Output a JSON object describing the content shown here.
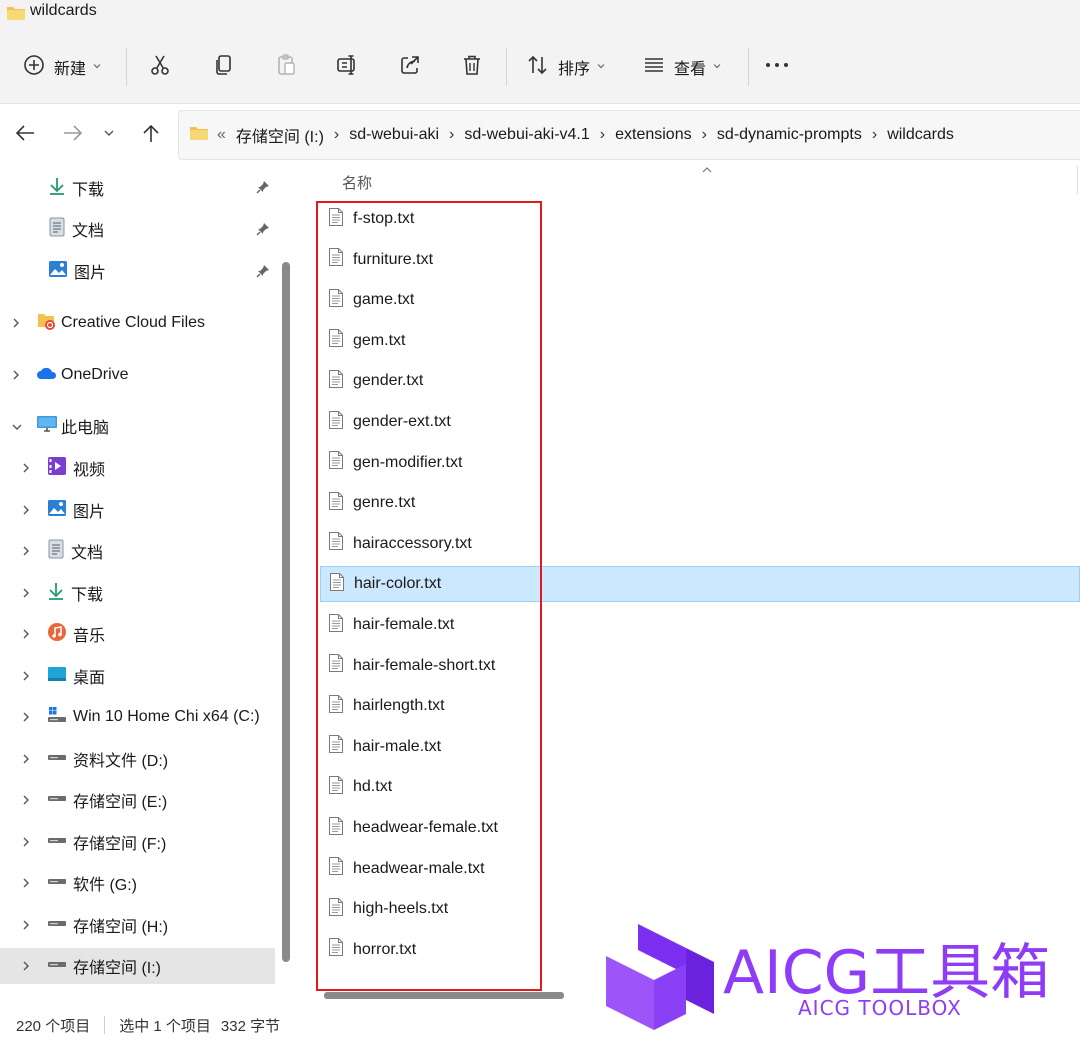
{
  "window": {
    "title": "wildcards"
  },
  "toolbar": {
    "new_label": "新建",
    "sort_label": "排序",
    "view_label": "查看",
    "icons": [
      "plus-circle-icon",
      "cut-icon",
      "copy-icon",
      "paste-icon",
      "rename-icon",
      "share-icon",
      "delete-icon",
      "sort-icon",
      "view-icon",
      "more-icon"
    ]
  },
  "addressbar": {
    "overflow": "«",
    "crumbs": [
      "存储空间 (I:)",
      "sd-webui-aki",
      "sd-webui-aki-v4.1",
      "extensions",
      "sd-dynamic-prompts",
      "wildcards"
    ],
    "separator": "›"
  },
  "sidebar": {
    "quick_access": [
      {
        "label": "下载",
        "icon": "download-icon",
        "pinned": true
      },
      {
        "label": "文档",
        "icon": "document-icon",
        "pinned": true
      },
      {
        "label": "图片",
        "icon": "pictures-icon",
        "pinned": true
      }
    ],
    "roots": [
      {
        "label": "Creative Cloud Files",
        "icon": "creative-cloud-folder-icon"
      },
      {
        "label": "OneDrive",
        "icon": "onedrive-icon"
      },
      {
        "label": "此电脑",
        "icon": "this-pc-icon"
      }
    ],
    "this_pc": [
      {
        "label": "视频",
        "icon": "videos-icon"
      },
      {
        "label": "图片",
        "icon": "pictures-icon"
      },
      {
        "label": "文档",
        "icon": "document-icon"
      },
      {
        "label": "下载",
        "icon": "download-icon"
      },
      {
        "label": "音乐",
        "icon": "music-icon"
      },
      {
        "label": "桌面",
        "icon": "desktop-icon"
      },
      {
        "label": "Win 10 Home Chi x64 (C:)",
        "icon": "windows-drive-icon"
      },
      {
        "label": "资料文件 (D:)",
        "icon": "drive-icon"
      },
      {
        "label": "存储空间 (E:)",
        "icon": "drive-icon"
      },
      {
        "label": "存储空间 (F:)",
        "icon": "drive-icon"
      },
      {
        "label": "软件 (G:)",
        "icon": "drive-icon"
      },
      {
        "label": "存储空间 (H:)",
        "icon": "drive-icon"
      },
      {
        "label": "存储空间 (I:)",
        "icon": "drive-icon",
        "selected": true
      }
    ]
  },
  "file_list": {
    "column_header": "名称",
    "files": [
      "f-stop.txt",
      "furniture.txt",
      "game.txt",
      "gem.txt",
      "gender.txt",
      "gender-ext.txt",
      "gen-modifier.txt",
      "genre.txt",
      "hairaccessory.txt",
      "hair-color.txt",
      "hair-female.txt",
      "hair-female-short.txt",
      "hairlength.txt",
      "hair-male.txt",
      "hd.txt",
      "headwear-female.txt",
      "headwear-male.txt",
      "high-heels.txt",
      "horror.txt"
    ],
    "selected_file": "hair-color.txt",
    "highlight_color": "#e11919"
  },
  "status": {
    "item_count": "220 个项目",
    "selection": "选中 1 个项目",
    "size": "332 字节"
  },
  "watermark": {
    "title": "AICG工具箱",
    "subtitle": "AICG TOOLBOX",
    "color": "#8f3cf7"
  }
}
